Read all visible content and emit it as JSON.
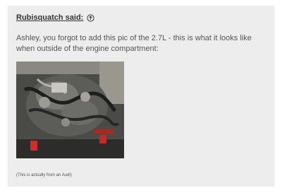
{
  "quote": {
    "author_said": "Rubisquatch said:",
    "expand_icon": "arrow-up-circle-icon",
    "text": "Ashley, you forgot to add this pic of the 2.7L - this is what it looks like when outside of the engine compartment:",
    "image_icon": "engine-photo",
    "footnote": "(This is actually from an Audi)"
  },
  "colors": {
    "background": "#ededed",
    "text": "#555555",
    "author": "#333333"
  }
}
